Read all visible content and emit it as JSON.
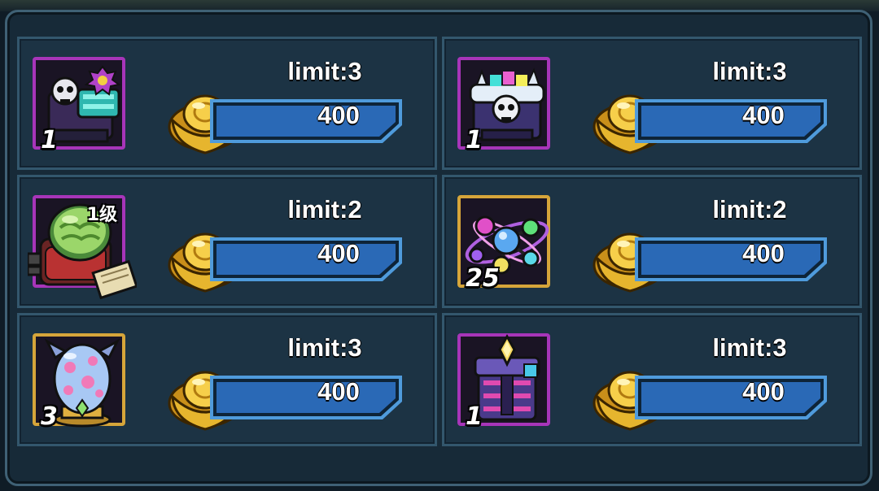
{
  "shop": {
    "items": [
      {
        "name": "skull-chest",
        "quantity": "1",
        "level_badge": "",
        "limit": "limit:3",
        "price": "400",
        "frame": "purple",
        "currency_icon": "gold-ingot-icon"
      },
      {
        "name": "frost-skull-chest",
        "quantity": "1",
        "level_badge": "",
        "limit": "limit:3",
        "price": "400",
        "frame": "purple",
        "currency_icon": "gold-ingot-icon"
      },
      {
        "name": "brain-tank",
        "quantity": "",
        "level_badge": "1级",
        "limit": "limit:2",
        "price": "400",
        "frame": "purple",
        "currency_icon": "gold-ingot-icon"
      },
      {
        "name": "molecule-orb",
        "quantity": "25",
        "level_badge": "",
        "limit": "limit:2",
        "price": "400",
        "frame": "gold",
        "currency_icon": "gold-ingot-icon"
      },
      {
        "name": "monster-egg",
        "quantity": "3",
        "level_badge": "",
        "limit": "limit:3",
        "price": "400",
        "frame": "gold",
        "currency_icon": "gold-ingot-icon"
      },
      {
        "name": "crystal-chest",
        "quantity": "1",
        "level_badge": "",
        "limit": "limit:3",
        "price": "400",
        "frame": "purple",
        "currency_icon": "gold-ingot-icon"
      }
    ]
  },
  "colors": {
    "frame_purple": "#a735b9",
    "frame_gold": "#d6a53a",
    "price_bar": "#2a69b6",
    "price_bar_border": "#4f9bdc",
    "panel_bg": "#172a38"
  }
}
